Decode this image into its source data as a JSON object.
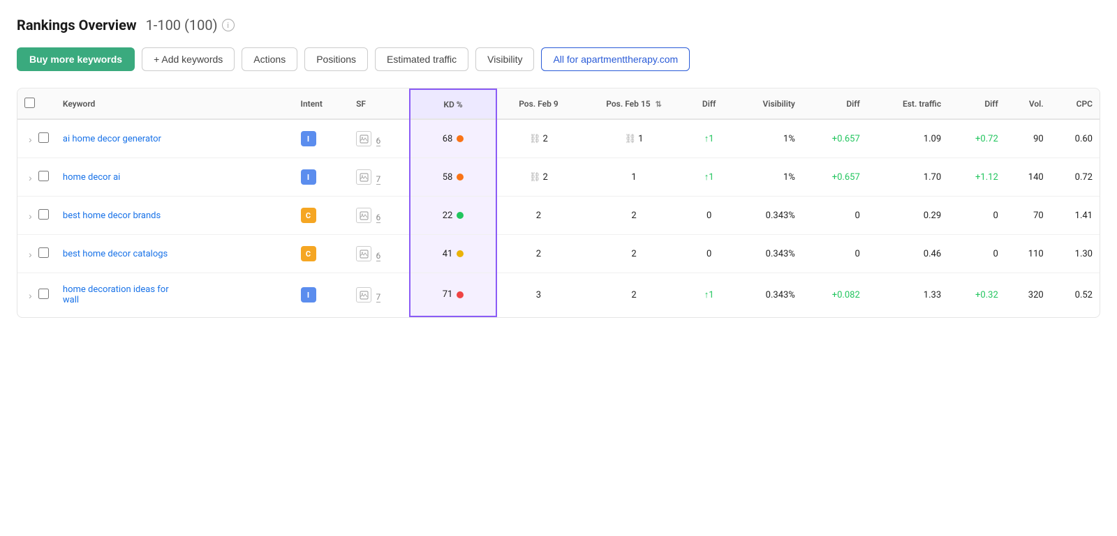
{
  "header": {
    "title": "Rankings Overview",
    "range": "1-100 (100)",
    "info_icon": "i"
  },
  "toolbar": {
    "buy_keywords": "Buy more keywords",
    "add_keywords": "+ Add keywords",
    "actions": "Actions",
    "tabs": [
      "Positions",
      "Estimated traffic",
      "Visibility"
    ],
    "active_filter": "All for apartmenttherapy.com"
  },
  "columns": {
    "keyword": "Keyword",
    "intent": "Intent",
    "sf": "SF",
    "kd": "KD %",
    "pos_feb9": "Pos. Feb 9",
    "pos_feb15": "Pos. Feb 15",
    "diff": "Diff",
    "visibility": "Visibility",
    "vis_diff": "Diff",
    "est_traffic": "Est. traffic",
    "est_diff": "Diff",
    "vol": "Vol.",
    "cpc": "CPC"
  },
  "rows": [
    {
      "keyword": "ai home decor generator",
      "intent": "I",
      "sf_icon": "image",
      "sf_num": "6",
      "kd": "68",
      "kd_dot": "orange",
      "pos_feb9_icon": "chain",
      "pos_feb9": "2",
      "pos_feb15_icon": "chain",
      "pos_feb15": "1",
      "diff": "↑1",
      "diff_color": "green",
      "visibility": "1%",
      "vis_diff": "+0.657",
      "vis_diff_color": "green",
      "est_traffic": "1.09",
      "est_diff": "+0.72",
      "est_diff_color": "green",
      "vol": "90",
      "cpc": "0.60"
    },
    {
      "keyword": "home decor ai",
      "intent": "I",
      "sf_icon": "image",
      "sf_num": "7",
      "kd": "58",
      "kd_dot": "orange",
      "pos_feb9_icon": "chain",
      "pos_feb9": "2",
      "pos_feb15_icon": "",
      "pos_feb15": "1",
      "diff": "↑1",
      "diff_color": "green",
      "visibility": "1%",
      "vis_diff": "+0.657",
      "vis_diff_color": "green",
      "est_traffic": "1.70",
      "est_diff": "+1.12",
      "est_diff_color": "green",
      "vol": "140",
      "cpc": "0.72"
    },
    {
      "keyword": "best home decor brands",
      "intent": "C",
      "sf_icon": "image",
      "sf_num": "6",
      "kd": "22",
      "kd_dot": "green",
      "pos_feb9_icon": "",
      "pos_feb9": "2",
      "pos_feb15_icon": "",
      "pos_feb15": "2",
      "diff": "0",
      "diff_color": "neutral",
      "visibility": "0.343%",
      "vis_diff": "0",
      "vis_diff_color": "neutral",
      "est_traffic": "0.29",
      "est_diff": "0",
      "est_diff_color": "neutral",
      "vol": "70",
      "cpc": "1.41"
    },
    {
      "keyword": "best home decor catalogs",
      "intent": "C",
      "sf_icon": "image",
      "sf_num": "6",
      "kd": "41",
      "kd_dot": "yellow",
      "pos_feb9_icon": "",
      "pos_feb9": "2",
      "pos_feb15_icon": "",
      "pos_feb15": "2",
      "diff": "0",
      "diff_color": "neutral",
      "visibility": "0.343%",
      "vis_diff": "0",
      "vis_diff_color": "neutral",
      "est_traffic": "0.46",
      "est_diff": "0",
      "est_diff_color": "neutral",
      "vol": "110",
      "cpc": "1.30"
    },
    {
      "keyword": "home decoration ideas for wall",
      "keyword_line2": "wall",
      "intent": "I",
      "sf_icon": "image",
      "sf_num": "7",
      "kd": "71",
      "kd_dot": "red",
      "pos_feb9_icon": "",
      "pos_feb9": "3",
      "pos_feb15_icon": "",
      "pos_feb15": "2",
      "diff": "↑1",
      "diff_color": "green",
      "visibility": "0.343%",
      "vis_diff": "+0.082",
      "vis_diff_color": "green",
      "est_traffic": "1.33",
      "est_diff": "+0.32",
      "est_diff_color": "green",
      "vol": "320",
      "cpc": "0.52"
    }
  ],
  "colors": {
    "green": "#22c55e",
    "orange": "#f97316",
    "yellow": "#eab308",
    "red": "#ef4444",
    "purple": "#8b5cf6",
    "link_blue": "#1a73e8",
    "primary_btn": "#3aaa7e"
  }
}
